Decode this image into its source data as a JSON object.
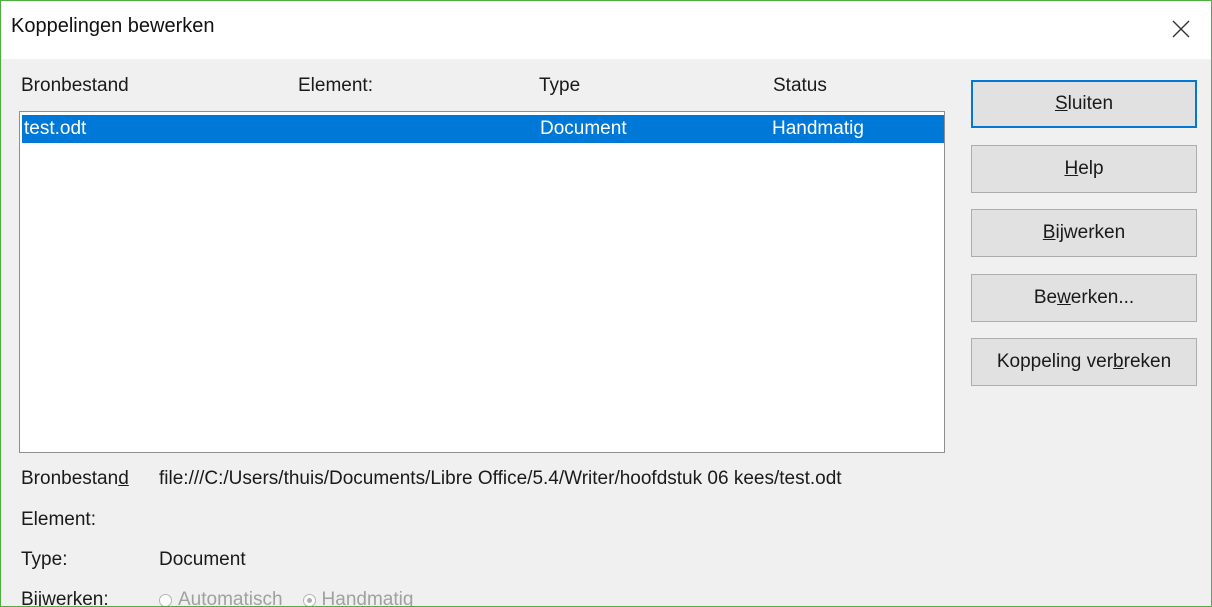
{
  "window": {
    "title": "Koppelingen bewerken"
  },
  "list": {
    "columns": [
      "Bronbestand",
      "Element:",
      "Type",
      "Status"
    ],
    "rows": [
      {
        "source": "test.odt",
        "element": "",
        "type": "Document",
        "status": "Handmatig",
        "selected": true
      }
    ]
  },
  "buttons": {
    "close": {
      "pre": "",
      "u": "S",
      "post": "luiten"
    },
    "help": {
      "pre": "",
      "u": "H",
      "post": "elp"
    },
    "update": {
      "pre": "",
      "u": "B",
      "post": "ijwerken"
    },
    "edit": {
      "pre": "Be",
      "u": "w",
      "post": "erken..."
    },
    "break": {
      "pre": "Koppeling ver",
      "u": "b",
      "post": "reken"
    }
  },
  "details": {
    "source_label_pre": "Bronbestan",
    "source_label_u": "d",
    "source_value": "file:///C:/Users/thuis/Documents/Libre Office/5.4/Writer/hoofdstuk 06 kees/test.odt",
    "element_label": "Element:",
    "element_value": "",
    "type_label": "Type:",
    "type_value": "Document",
    "update_label": "Bijwerken:",
    "update_options": [
      "Automatisch",
      "Handmatig"
    ],
    "update_selected": "Handmatig"
  },
  "colors": {
    "selection": "#0078d7",
    "window_border": "#4caf3f",
    "default_button_border": "#0078d7"
  }
}
